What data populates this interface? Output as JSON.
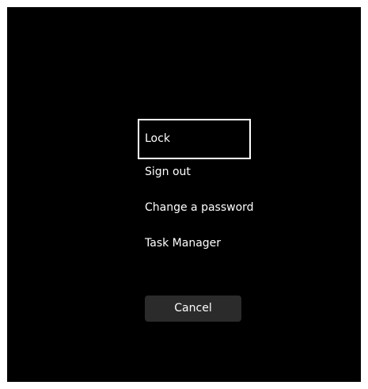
{
  "security_options": {
    "items": [
      {
        "label": "Lock",
        "focused": true
      },
      {
        "label": "Sign out",
        "focused": false
      },
      {
        "label": "Change a password",
        "focused": false
      },
      {
        "label": "Task Manager",
        "focused": false
      }
    ],
    "cancel_label": "Cancel"
  },
  "colors": {
    "background": "#000000",
    "text": "#ffffff",
    "focus_border": "#ffffff",
    "button_background": "#2b2b2b"
  }
}
